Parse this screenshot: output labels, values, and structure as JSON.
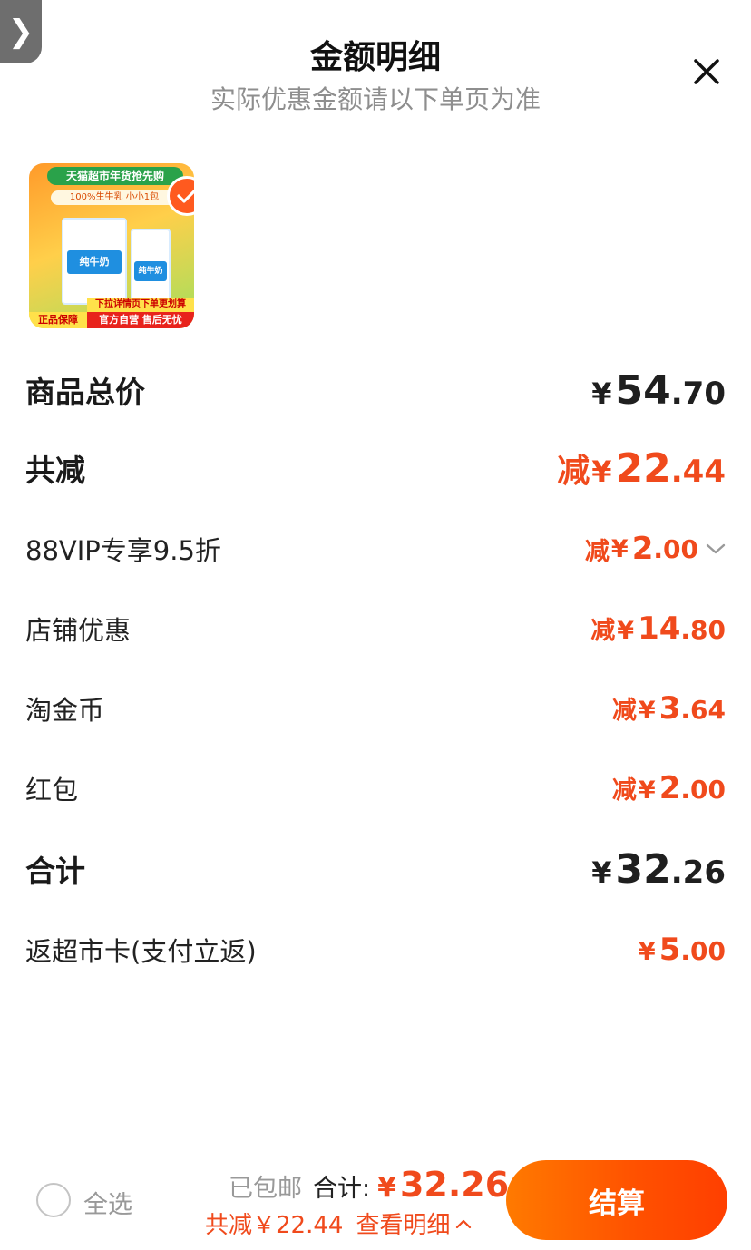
{
  "header": {
    "title": "金额明细",
    "subtitle": "实际优惠金额请以下单页为准",
    "side_tab_glyph": "❯"
  },
  "product": {
    "banner": "天猫超市年货抢先购",
    "tagline": "100%生牛乳 小小1包",
    "box_label_1": "纯牛奶",
    "box_label_2": "纯牛奶",
    "strip_yellow": "下拉详情页下单更划算",
    "strip_red": "官方自营 售后无忧",
    "strip_left": "正品保障",
    "selected": true
  },
  "rows": {
    "total": {
      "label": "商品总价",
      "currency": "¥",
      "int": "54",
      "dec": ".70"
    },
    "reduce": {
      "label": "共减",
      "prefix": "减",
      "currency": "¥",
      "int": "22",
      "dec": ".44"
    },
    "vip": {
      "label": "88VIP专享9.5折",
      "prefix": "减",
      "currency": "¥",
      "int": "2",
      "dec": ".00"
    },
    "shop": {
      "label": "店铺优惠",
      "prefix": "减",
      "currency": "¥",
      "int": "14",
      "dec": ".80"
    },
    "coin": {
      "label": "淘金币",
      "prefix": "减",
      "currency": "¥",
      "int": "3",
      "dec": ".64"
    },
    "redpack": {
      "label": "红包",
      "prefix": "减",
      "currency": "¥",
      "int": "2",
      "dec": ".00"
    },
    "sum": {
      "label": "合计",
      "currency": "¥",
      "int": "32",
      "dec": ".26"
    },
    "cashback": {
      "label": "返超市卡(支付立返)",
      "currency": "¥",
      "int": "5",
      "dec": ".00"
    }
  },
  "bottom": {
    "select_all": "全选",
    "shipping": "已包邮",
    "total_label": "合计:",
    "currency": "¥",
    "total_value": "32.26",
    "reduce_text": "共减￥22.44",
    "view_detail": "查看明细",
    "checkout": "结算"
  },
  "colors": {
    "accent": "#f04a1c",
    "button_start": "#ff7a00",
    "button_end": "#ff3f00"
  }
}
